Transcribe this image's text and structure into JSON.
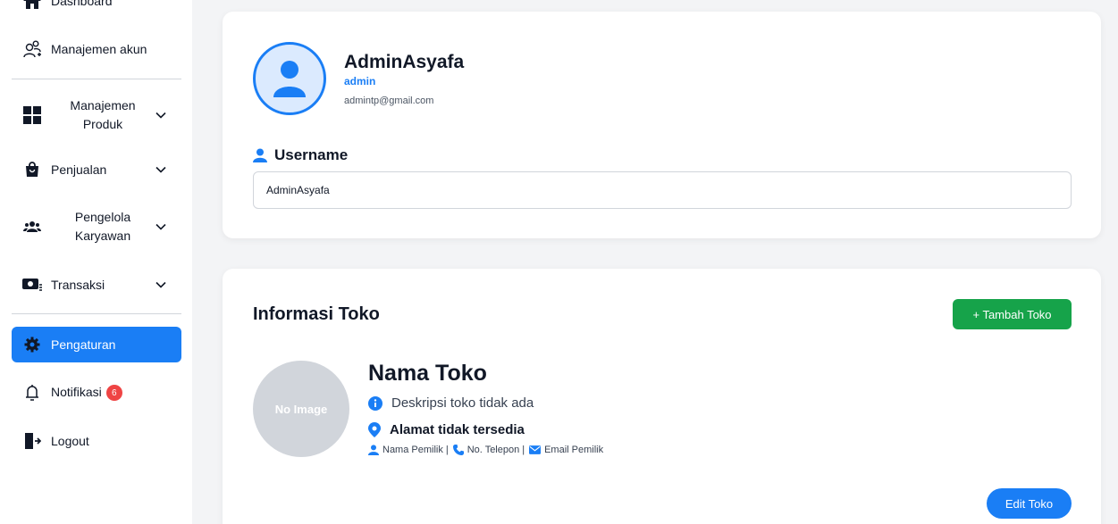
{
  "sidebar": {
    "dashboard": "Dashboard",
    "akun": "Manajemen akun",
    "produk_1": "Manajemen",
    "produk_2": "Produk",
    "penjualan": "Penjualan",
    "karyawan_1": "Pengelola",
    "karyawan_2": "Karyawan",
    "transaksi": "Transaksi",
    "pengaturan": "Pengaturan",
    "notifikasi": "Notifikasi",
    "notif_count": "6",
    "logout": "Logout"
  },
  "profile": {
    "name": "AdminAsyafa",
    "role": "admin",
    "email": "admintp@gmail.com",
    "username_label": "Username",
    "username_value": "AdminAsyafa"
  },
  "store": {
    "section_title": "Informasi Toko",
    "add_button": "+ Tambah Toko",
    "image_placeholder": "No Image",
    "name": "Nama Toko",
    "description": "Deskripsi toko tidak ada",
    "address": "Alamat tidak tersedia",
    "owner": "Nama Pemilik",
    "phone": "No. Telepon",
    "email": "Email Pemilik",
    "edit_button": "Edit Toko"
  },
  "colors": {
    "primary": "#1a7ef5",
    "success": "#16a34a",
    "badge": "#ef4444"
  }
}
